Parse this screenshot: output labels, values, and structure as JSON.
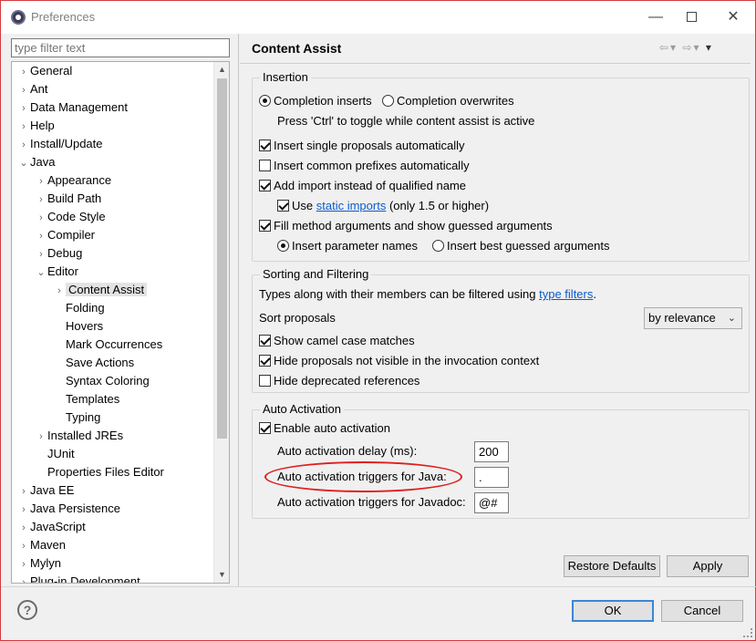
{
  "window": {
    "title": "Preferences"
  },
  "filter": {
    "placeholder": "type filter text"
  },
  "tree": [
    {
      "label": "General",
      "indent": 0,
      "twisty": "›"
    },
    {
      "label": "Ant",
      "indent": 0,
      "twisty": "›"
    },
    {
      "label": "Data Management",
      "indent": 0,
      "twisty": "›"
    },
    {
      "label": "Help",
      "indent": 0,
      "twisty": "›"
    },
    {
      "label": "Install/Update",
      "indent": 0,
      "twisty": "›"
    },
    {
      "label": "Java",
      "indent": 0,
      "twisty": "⌄"
    },
    {
      "label": "Appearance",
      "indent": 1,
      "twisty": "›"
    },
    {
      "label": "Build Path",
      "indent": 1,
      "twisty": "›"
    },
    {
      "label": "Code Style",
      "indent": 1,
      "twisty": "›"
    },
    {
      "label": "Compiler",
      "indent": 1,
      "twisty": "›"
    },
    {
      "label": "Debug",
      "indent": 1,
      "twisty": "›"
    },
    {
      "label": "Editor",
      "indent": 1,
      "twisty": "⌄"
    },
    {
      "label": "Content Assist",
      "indent": 2,
      "twisty": "›",
      "selected": true
    },
    {
      "label": "Folding",
      "indent": 2,
      "twisty": ""
    },
    {
      "label": "Hovers",
      "indent": 2,
      "twisty": ""
    },
    {
      "label": "Mark Occurrences",
      "indent": 2,
      "twisty": ""
    },
    {
      "label": "Save Actions",
      "indent": 2,
      "twisty": ""
    },
    {
      "label": "Syntax Coloring",
      "indent": 2,
      "twisty": ""
    },
    {
      "label": "Templates",
      "indent": 2,
      "twisty": ""
    },
    {
      "label": "Typing",
      "indent": 2,
      "twisty": ""
    },
    {
      "label": "Installed JREs",
      "indent": 1,
      "twisty": "›"
    },
    {
      "label": "JUnit",
      "indent": 1,
      "twisty": ""
    },
    {
      "label": "Properties Files Editor",
      "indent": 1,
      "twisty": ""
    },
    {
      "label": "Java EE",
      "indent": 0,
      "twisty": "›"
    },
    {
      "label": "Java Persistence",
      "indent": 0,
      "twisty": "›"
    },
    {
      "label": "JavaScript",
      "indent": 0,
      "twisty": "›"
    },
    {
      "label": "Maven",
      "indent": 0,
      "twisty": "›"
    },
    {
      "label": "Mylyn",
      "indent": 0,
      "twisty": "›"
    },
    {
      "label": "Plug-in Development",
      "indent": 0,
      "twisty": "›"
    }
  ],
  "page": {
    "title": "Content Assist",
    "insertion": {
      "title": "Insertion",
      "completion_inserts": "Completion inserts",
      "completion_overwrites": "Completion overwrites",
      "toggle_hint": "Press 'Ctrl' to toggle while content assist is active",
      "insert_single": "Insert single proposals automatically",
      "insert_common": "Insert common prefixes automatically",
      "add_import": "Add import instead of qualified name",
      "use": "Use",
      "static_imports": "static imports",
      "only_15": "(only 1.5 or higher)",
      "fill_method": "Fill method arguments and show guessed arguments",
      "insert_param_names": "Insert parameter names",
      "insert_best_guessed": "Insert best guessed arguments"
    },
    "sorting": {
      "title": "Sorting and Filtering",
      "types_text": "Types along with their members can be filtered using",
      "type_filters": "type filters",
      "period": ".",
      "sort_proposals": "Sort proposals",
      "sort_value": "by relevance",
      "camel_case": "Show camel case matches",
      "hide_not_visible": "Hide proposals not visible in the invocation context",
      "hide_deprecated": "Hide deprecated references"
    },
    "auto_activation": {
      "title": "Auto Activation",
      "enable": "Enable auto activation",
      "delay_label": "Auto activation delay (ms):",
      "delay_value": "200",
      "java_label": "Auto activation triggers for Java:",
      "java_value": ".",
      "javadoc_label": "Auto activation triggers for Javadoc:",
      "javadoc_value": "@#"
    },
    "restore_defaults": "Restore Defaults",
    "apply": "Apply"
  },
  "footer": {
    "help": "?",
    "ok": "OK",
    "cancel": "Cancel"
  },
  "colors": {
    "link": "#0b5bcd",
    "annotation": "#e01e1e",
    "primary_border": "#3b86d6"
  }
}
